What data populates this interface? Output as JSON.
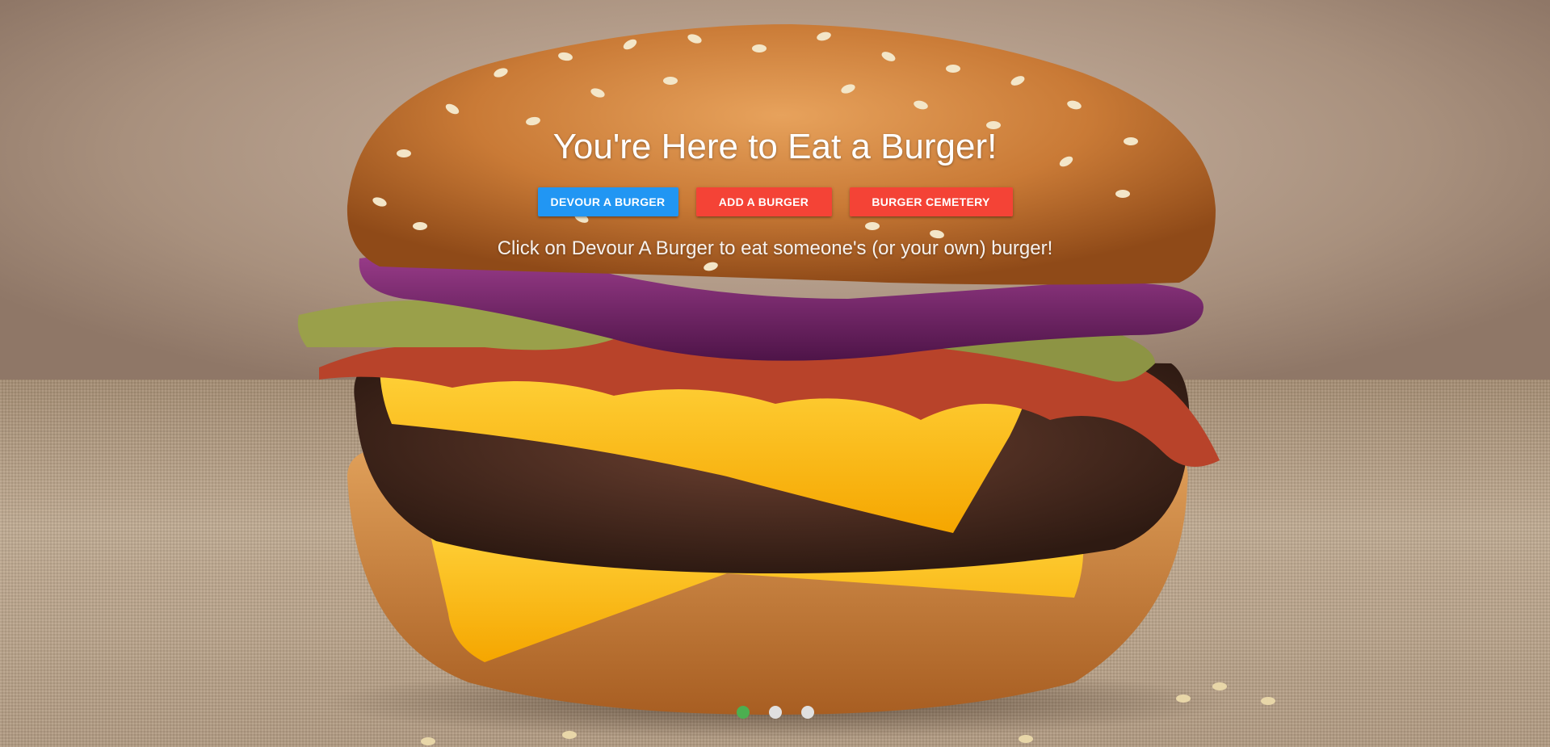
{
  "hero": {
    "title": "You're Here to Eat a Burger!",
    "subtitle": "Click on Devour A Burger to eat someone's (or your own) burger!",
    "background_image": "burger-photo"
  },
  "buttons": [
    {
      "label": "DEVOUR A BURGER",
      "color": "#2196f3"
    },
    {
      "label": "ADD A BURGER",
      "color": "#f44336"
    },
    {
      "label": "BURGER CEMETERY",
      "color": "#f44336"
    }
  ],
  "carousel": {
    "slide_count": 3,
    "active_index": 0,
    "active_color": "#4caf50",
    "inactive_color": "#e0e0e0"
  }
}
